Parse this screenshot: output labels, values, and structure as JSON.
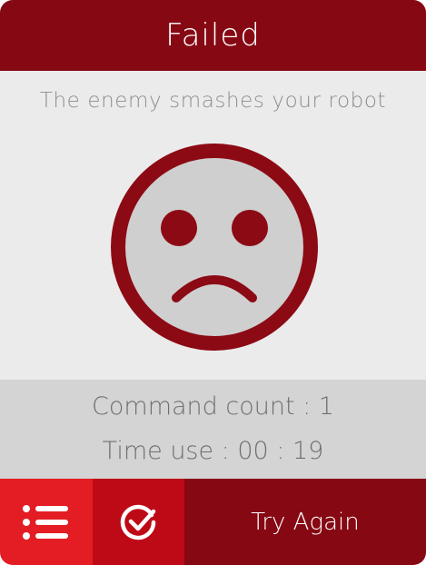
{
  "dialog": {
    "title": "Failed",
    "message": "The enemy smashes your robot",
    "face_icon": "sad-face-icon"
  },
  "stats": {
    "command_count": "Command count : 1",
    "time_use": "Time use : 00 : 19"
  },
  "footer": {
    "menu_icon": "list-menu-icon",
    "check_icon": "check-circle-icon",
    "retry_label": "Try Again"
  },
  "colors": {
    "header_bg": "#860813",
    "body_bg": "#ebebeb",
    "stats_bg": "#d4d4d4",
    "menu_button_bg": "#e31d23",
    "check_button_bg": "#be0a16",
    "retry_button_bg": "#860813",
    "face_ring": "#8c0a14",
    "face_fill": "#cfcfcf"
  }
}
